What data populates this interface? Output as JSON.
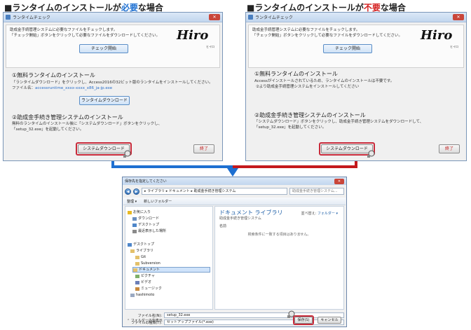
{
  "headings": {
    "left_prefix": "■ランタイムのインストールが",
    "left_em": "必要",
    "left_suffix": "な場合",
    "right_prefix": "■ランタイムのインストールが",
    "right_em": "不要",
    "right_suffix": "な場合"
  },
  "colors": {
    "blue_arrow": "#1d6fd1",
    "red_arrow": "#c4191c",
    "highlight": "#c82a3a"
  },
  "left_window": {
    "title": "ランタイムチェック",
    "intro1": "助成金手続管理システムに必要なファイルをチェックします。",
    "intro2": "「チェック開始」ボタンをクリックして必要なファイルをダウンロードしてください。",
    "check_button": "チェック開始",
    "logo": "Hiro",
    "logo_sub": "ヒイロ",
    "section1_title": "①無料ランタイムのインストール",
    "section1_line1": "「ランタイムダウンロード」をクリックし、Access2016の32ビット版のランタイムをインストールしてください。",
    "section1_line2_label": "ファイル名：",
    "section1_line2_file": "accessruntime_xxxx-xxxx_x86_ja-jp.exe",
    "runtime_button": "ランタイムダウンロード",
    "section2_title": "②助成金手続き管理システムのインストール",
    "section2_line1": "無料のランタイムのインストール後に「システムダウンロード」ボタンをクリックし、",
    "section2_line2": "「setup_32.exe」を起動してください。",
    "system_button": "システムダウンロード",
    "exit_button": "終了"
  },
  "right_window": {
    "title": "ランタイムチェック",
    "intro1": "助成金手続管理システムに必要なファイルをチェックします。",
    "intro2": "「チェック開始」ボタンをクリックして必要なファイルをダウンロードしてください。",
    "check_button": "チェック開始",
    "logo": "Hiro",
    "logo_sub": "ヒイロ",
    "section1_title": "①無料ランタイムのインストール",
    "section1_line1": "Accessがインストールされているため、ランタイムのインストールは不要です。",
    "section1_line2": "②より助成金手続管理システムをインストールしてください",
    "section2_title": "②助成金手続き管理システムのインストール",
    "section2_line1": "「システムダウンロード」ボタンをクリックし、助成金手続き管理システムをダウンロードして、",
    "section2_line2": "「setup_32.exe」を起動してください。",
    "system_button": "システムダウンロード",
    "exit_button": "終了"
  },
  "save_dialog": {
    "title": "保存先を指定してください",
    "breadcrumb": "▸ ライブラリ ▸ ドキュメント ▸ 助成金手続き管理システム",
    "search_placeholder": "助成金手続き管理システム...",
    "organize": "整理 ▾",
    "new_folder": "新しいフォルダー",
    "tree": {
      "favorites": "お気に入り",
      "downloads": "ダウンロード",
      "desktop_fav": "デスクトップ",
      "recent": "最近表示した場所",
      "desktop": "デスクトップ",
      "libraries": "ライブラリ",
      "git": "Git",
      "subversion": "Subversion",
      "documents": "ドキュメント",
      "pictures": "ピクチャ",
      "videos": "ビデオ",
      "music": "ミュージック",
      "hashimoto": "hashimoto"
    },
    "library_title": "ドキュメント ライブラリ",
    "library_sub": "助成金手続き管理システム",
    "arrange_label": "並べ替え:",
    "arrange_value": "フォルダー ▾",
    "col_name": "名前",
    "empty_msg": "検索条件に一致する項目はありません。",
    "filename_label": "ファイル名(N):",
    "filename_value": "setup_32.exe",
    "filetype_label": "ファイルの種類(T):",
    "filetype_value": "セットアップファイル(*.exe)",
    "hide_folders": "フォルダーの非表示",
    "save_button": "保存(S)",
    "cancel_button": "キャンセル"
  }
}
